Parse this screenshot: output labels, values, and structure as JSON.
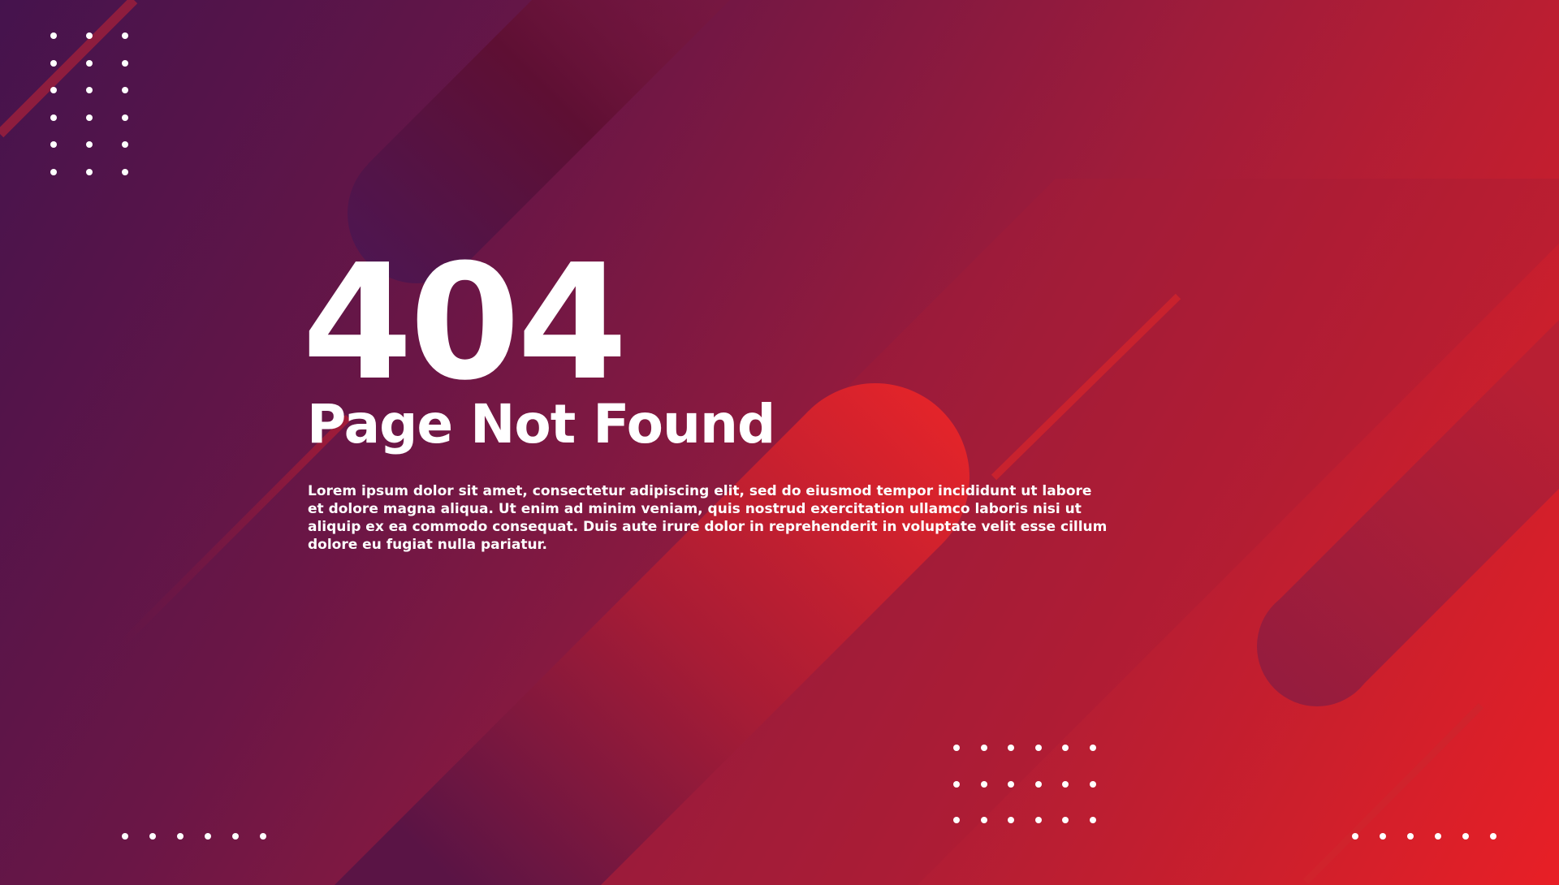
{
  "error": {
    "code": "404",
    "title": "Page Not Found",
    "description": "Lorem ipsum dolor sit amet, consectetur adipiscing elit, sed do eiusmod tempor incididunt ut labore et dolore magna aliqua. Ut enim ad minim veniam, quis nostrud exercitation ullamco laboris nisi ut aliquip ex ea commodo consequat. Duis aute irure dolor in reprehenderit in voluptate velit esse cillum dolore eu fugiat nulla pariatur."
  },
  "colors": {
    "background_start": "#45134d",
    "background_end": "#e81f26",
    "text": "#ffffff"
  }
}
